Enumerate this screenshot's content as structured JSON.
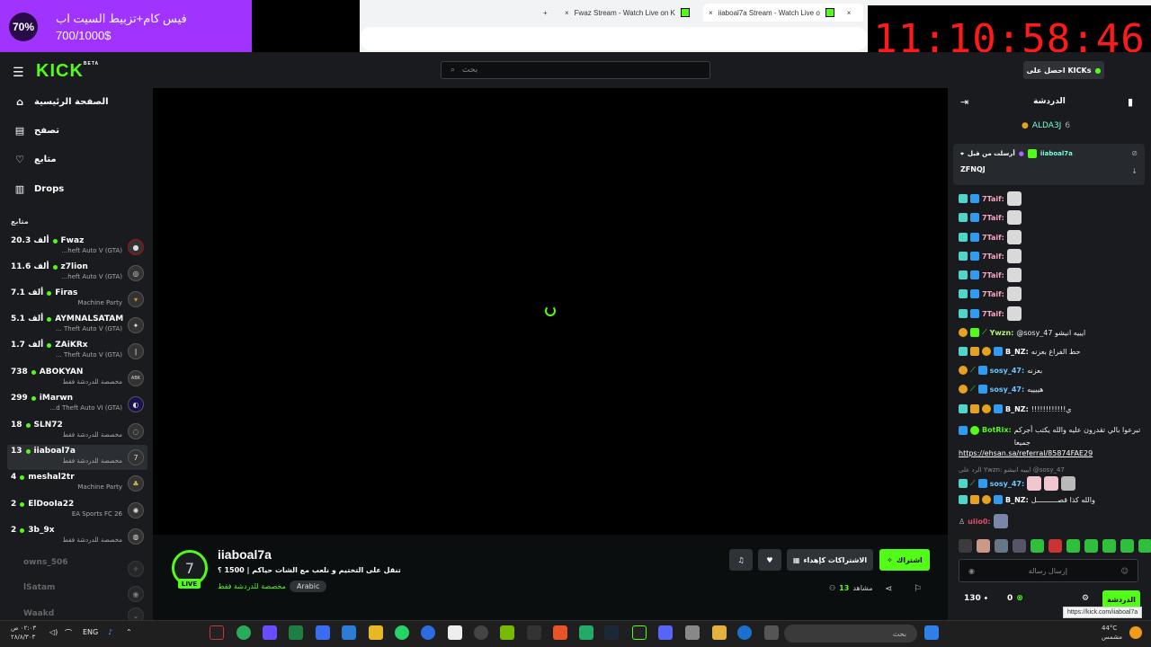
{
  "browser": {
    "tabs": [
      {
        "title": "Fwaz Stream - Watch Live on K"
      },
      {
        "title": "iiaboal7a Stream - Watch Live o"
      }
    ],
    "new_tab": "+",
    "close": "×",
    "status_url": "https://kick.com/iiaboal7a"
  },
  "overlay": {
    "percent": "70%",
    "goal_title": "فيس كام+تزبيط السيت اب",
    "goal_progress": "700/1000$",
    "goal_fraction": 0.7
  },
  "timer": "11:10:58:46",
  "header": {
    "logo": "KICK",
    "logo_beta": "BETA",
    "search_placeholder": "بحث",
    "kicks_button": "احصل على KICKs"
  },
  "sidebar": {
    "nav": [
      {
        "label": "الصفحة الرئيسية",
        "icon": "home-icon"
      },
      {
        "label": "تصفح",
        "icon": "browse-icon"
      },
      {
        "label": "متابع",
        "icon": "heart-icon"
      },
      {
        "label": "Drops",
        "icon": "drops-icon"
      }
    ],
    "section_title": "متابع",
    "channels": [
      {
        "viewers": "20.3 ألف",
        "name": "Fwaz",
        "category": "...heft Auto V (GTA)"
      },
      {
        "viewers": "11.6 ألف",
        "name": "z7lion",
        "category": "...heft Auto V (GTA)"
      },
      {
        "viewers": "7.1 ألف",
        "name": "Firas",
        "category": "Machine Party"
      },
      {
        "viewers": "5.1 ألف",
        "name": "AYMNALSATAM",
        "category": "... Theft Auto V (GTA)"
      },
      {
        "viewers": "1.7 ألف",
        "name": "ZAiKRx",
        "category": "... Theft Auto V (GTA)"
      },
      {
        "viewers": "738",
        "name": "ABOKYAN",
        "category": "مخصصة للدردشة فقط"
      },
      {
        "viewers": "299",
        "name": "iMarwn",
        "category": "...d Theft Auto VI (GTA)"
      },
      {
        "viewers": "18",
        "name": "SLN72",
        "category": "مخصصة للدردشة فقط"
      },
      {
        "viewers": "13",
        "name": "iiaboal7a",
        "category": "مخصصة للدردشة فقط"
      },
      {
        "viewers": "4",
        "name": "meshal2tr",
        "category": "Machine Party"
      },
      {
        "viewers": "2",
        "name": "ElDooIa22",
        "category": "EA Sports FC 26"
      },
      {
        "viewers": "2",
        "name": "3b_9x",
        "category": "مخصصة للدردشة فقط"
      }
    ],
    "offline": [
      {
        "name": "owns_506"
      },
      {
        "name": "lSatam"
      },
      {
        "name": "Waakd"
      }
    ]
  },
  "stream": {
    "name": "iiaboal7a",
    "live": "LIVE",
    "title": "تنقل على التختيم و نلعب مع الشات حياكم | 1500 ؟",
    "category": "مخصصة للدردشة فقط",
    "language": "Arabic",
    "follow": "اشتراك",
    "gift_subs": "الاشتراكات كإهداء",
    "viewers_label": "مشاهد",
    "viewers": "13"
  },
  "chat": {
    "title": "الدردشة",
    "top_gifter": {
      "name": "ALDA3J",
      "count": "6"
    },
    "pinned": {
      "label": "أرسلت من قبل",
      "author": "iiaboal7a",
      "text": "ZFNQJ"
    },
    "messages": [
      {
        "user": "7Taif:",
        "text": ""
      },
      {
        "user": "7Taif:",
        "text": ""
      },
      {
        "user": "7Taif:",
        "text": ""
      },
      {
        "user": "7Taif:",
        "text": ""
      },
      {
        "user": "7Taif:",
        "text": ""
      },
      {
        "user": "7Taif:",
        "text": ""
      },
      {
        "user": "7Taif:",
        "text": ""
      },
      {
        "user": "Ywzn:",
        "text": "@sosy_47 ايييه انيشو"
      },
      {
        "user": "B_NZ:",
        "text": "حط الفراغ بعزنه"
      },
      {
        "user": "sosy_47:",
        "text": "بعزنه"
      },
      {
        "user": "sosy_47:",
        "text": "هييييه"
      },
      {
        "user": "B_NZ:",
        "text": "!!!!!!!!!!!!ي"
      },
      {
        "user": "BotRix:",
        "text": "تبرعوا بالي تقدرون عليه والله يكتب أجركم جميعا"
      },
      {
        "user": "sosy_47:",
        "text": ""
      },
      {
        "user": "B_NZ:",
        "text": "والله كذا قصــــــــــل"
      },
      {
        "user": "uiio0:",
        "text": ""
      }
    ],
    "link": "https://ehsan.sa/referral/85874FAE29",
    "reply_hint": "الرد على Ywzn: ايييه انيشو @sosy_47",
    "input_placeholder": "إرسال رسالة",
    "points": "130",
    "kicks": "0",
    "send": "الدردشة"
  },
  "taskbar": {
    "search": "بحث",
    "lang": "ENG",
    "time": "٠٢:٠٣ ص",
    "date": "٢٨/٨/٣٠٣",
    "temp": "44°C",
    "weather": "مشمس"
  },
  "colors": {
    "accent": "#53fc18",
    "overlay": "#a133ff",
    "timer": "#ff1a1a"
  }
}
